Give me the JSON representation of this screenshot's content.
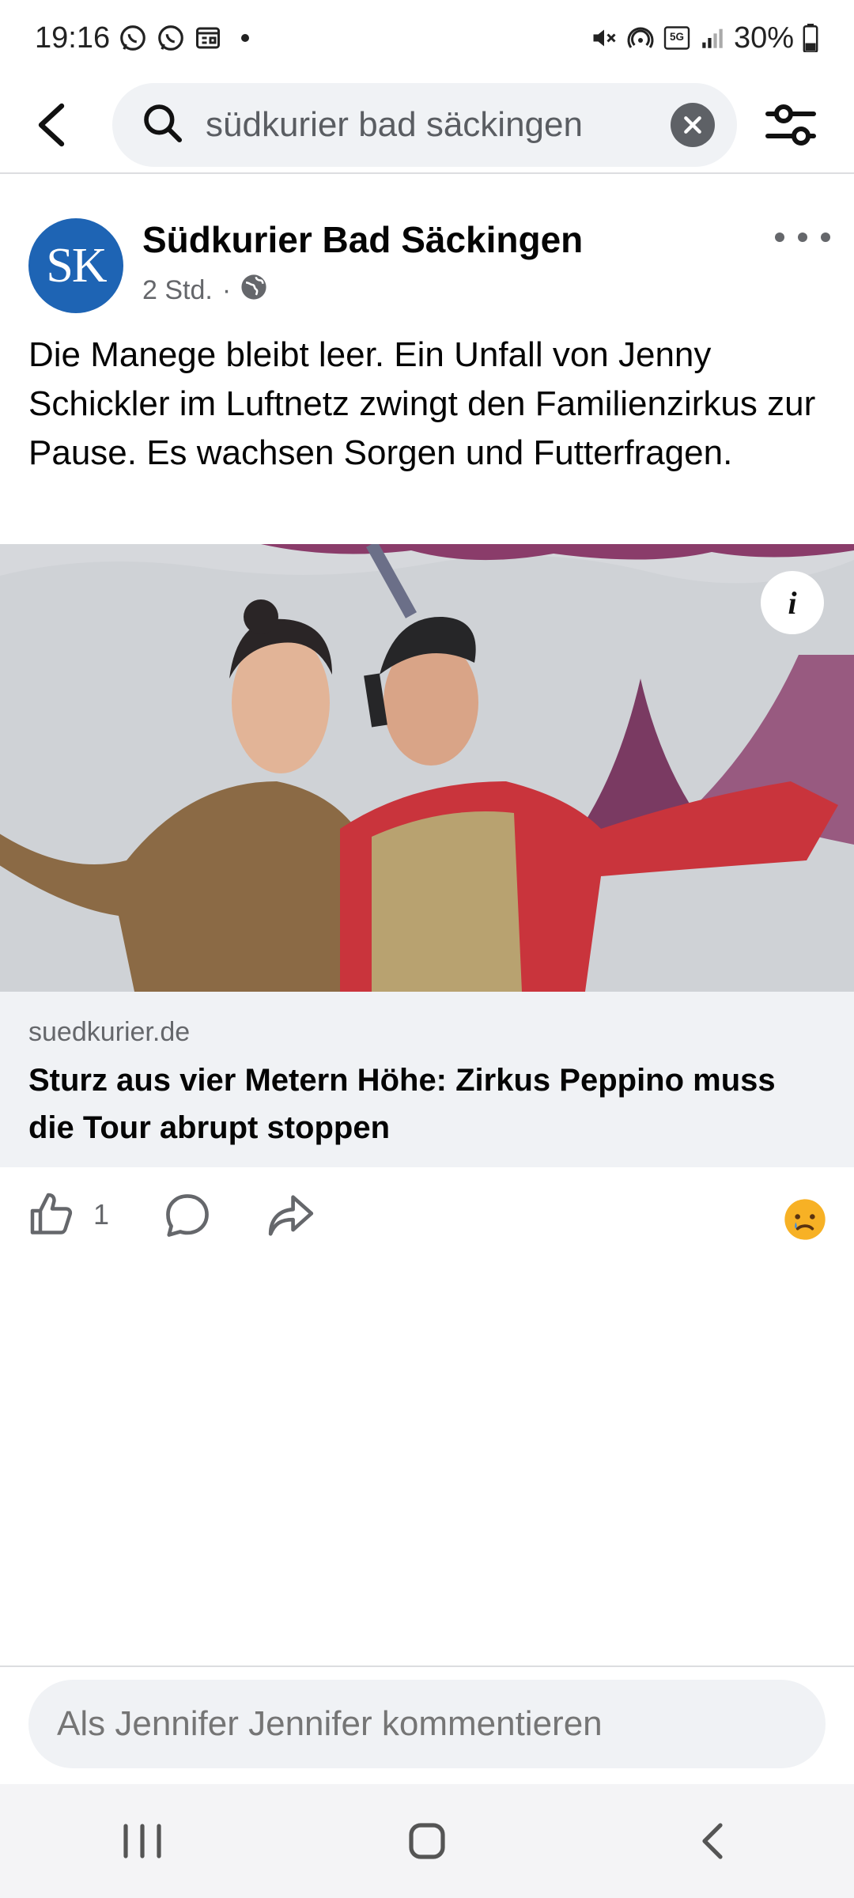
{
  "status_bar": {
    "time": "19:16",
    "battery": "30%",
    "network": "5G",
    "icons": [
      "whatsapp-icon",
      "whatsapp-icon",
      "news-icon",
      "mute-icon",
      "hotspot-icon",
      "5g-icon",
      "signal-icon",
      "battery-icon"
    ]
  },
  "search": {
    "query": "südkurier bad säckingen"
  },
  "post": {
    "avatar_text": "SK",
    "page_name": "Südkurier Bad Säckingen",
    "time": "2 Std.",
    "separator": "·",
    "audience_icon": "globe-icon",
    "text": "Die Manege bleibt leer. Ein Unfall von Jenny Schickler im Luftnetz zwingt den Familienzirkus zur Pause. Es wachsen Sorgen und Futterfragen.",
    "image_info_label": "i",
    "link_domain": "suedkurier.de",
    "link_title": "Sturz aus vier Metern Höhe: Zirkus Peppino muss die Tour abrupt stoppen",
    "like_count": "1",
    "reaction_icon": "sad-reaction-icon"
  },
  "comment": {
    "placeholder": "Als Jennifer Jennifer kommentieren"
  },
  "colors": {
    "accent_blue": "#1e64b4",
    "secondary_text": "#65676b",
    "surface_gray": "#f0f2f5"
  }
}
